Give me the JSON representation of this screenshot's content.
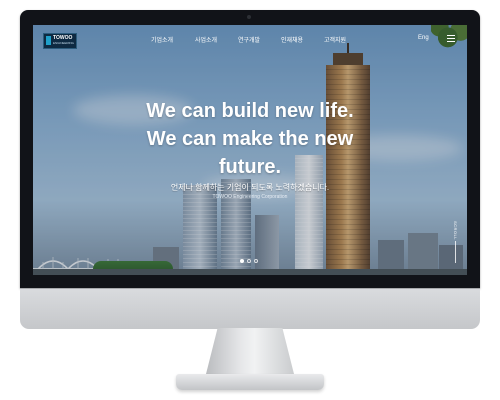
{
  "header": {
    "logo": {
      "name": "TOWOO",
      "sub": "ENGINEERING"
    },
    "nav": [
      {
        "label": "기업소개"
      },
      {
        "label": "사업소개"
      },
      {
        "label": "연구개발"
      },
      {
        "label": "인재채용"
      },
      {
        "label": "고객지원"
      }
    ],
    "lang_label": "Eng",
    "menu_icon": "hamburger-menu-icon"
  },
  "hero": {
    "line1": "We can build new life.",
    "line2": "We can make the new",
    "line3": "future.",
    "subtitle": "언제나 함께하는 기업이 되도록 노력하겠습니다.",
    "corp": "TOWOO Engineering Corporation"
  },
  "slider": {
    "count": 3,
    "active_index": 0
  },
  "scroll_label": "SCROLL",
  "colors": {
    "bezel": "#111318",
    "logo_bg": "#0e2a42",
    "logo_accent": "#1fa0c9",
    "text": "#ffffff"
  }
}
